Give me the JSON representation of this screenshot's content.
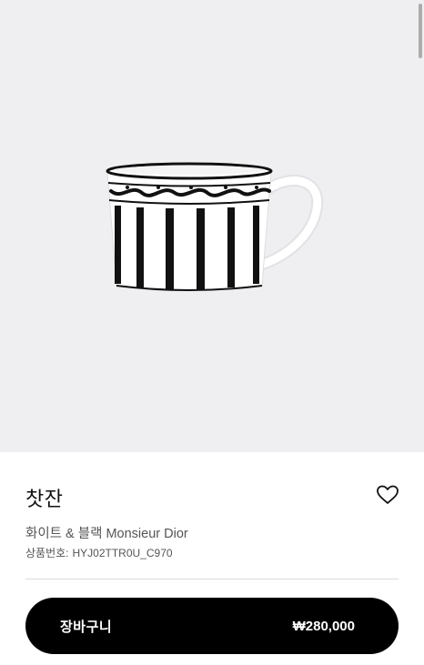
{
  "product": {
    "image_icon": "teacup-image",
    "title": "찻잔",
    "subtitle": "화이트 & 블랙 Monsieur Dior",
    "code_label": "상품번호:",
    "code_value": "HYJ02TTR0U_C970",
    "favorite_icon": "heart-outline-icon"
  },
  "cart": {
    "label": "장바구니",
    "price": "₩280,000"
  },
  "colors": {
    "hero_bg": "#efeff1",
    "button_bg": "#000000",
    "button_text": "#ffffff"
  }
}
